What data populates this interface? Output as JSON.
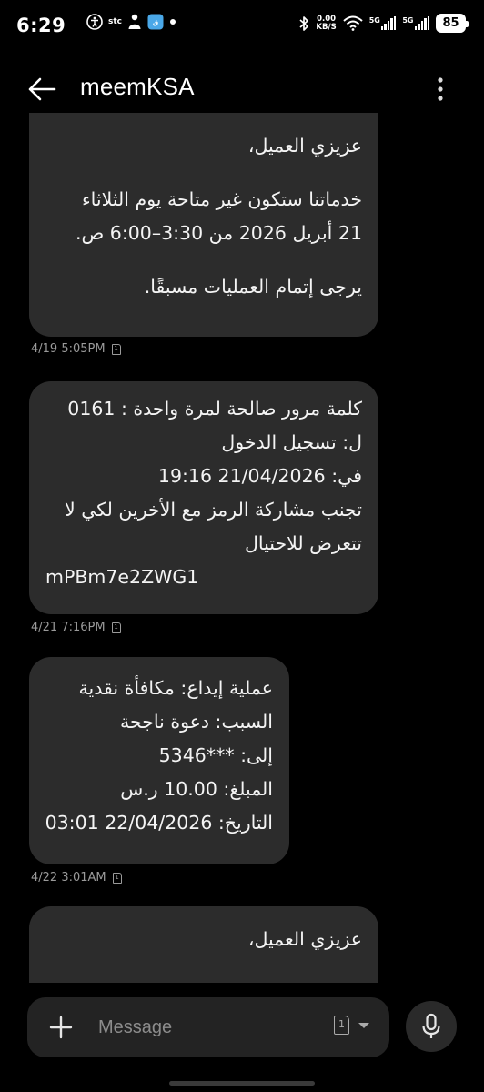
{
  "status_bar": {
    "time": "6:29",
    "carrier": "stc",
    "net_speed_value": "0.00",
    "net_speed_unit": "KB/S",
    "signal1_label": "5G",
    "signal2_label": "5G",
    "battery": "85"
  },
  "header": {
    "title": "meemKSA"
  },
  "messages": [
    {
      "lines": [
        "عزيزي العميل،",
        "",
        "خدماتنا ستكون غير متاحة يوم الثلاثاء",
        "21 أبريل 2026 من 3:30–6:00 ص.",
        "",
        "يرجى إتمام العمليات مسبقًا."
      ],
      "timestamp": "4/19 5:05PM",
      "sim": "1"
    },
    {
      "lines": [
        "كلمة مرور صالحة لمرة واحدة : 0161",
        "ل: تسجيل الدخول",
        "في: 21/04/2026 19:16",
        "تجنب مشاركة الرمز مع الأخرين لكي لا",
        "تتعرض للاحتيال",
        "mPBm7e2ZWG1"
      ],
      "timestamp": "4/21 7:16PM",
      "sim": "1"
    },
    {
      "lines": [
        "عملية إيداع: مكافأة نقدية",
        "السبب: دعوة ناجحة",
        "إلى: ***5346",
        "المبلغ: 10.00 ر.س",
        "التاريخ: 22/04/2026 03:01"
      ],
      "timestamp": "4/22 3:01AM",
      "sim": "1"
    },
    {
      "lines": [
        "عزيزي العميل،"
      ],
      "timestamp": "",
      "sim": ""
    }
  ],
  "compose": {
    "placeholder": "Message",
    "sim": "1"
  },
  "icons": {
    "back": "arrow-back-icon",
    "more": "more-vertical-icon",
    "add": "plus-icon",
    "mic": "microphone-icon",
    "sim": "sim-card-icon",
    "bluetooth": "bluetooth-icon",
    "wifi": "wifi-icon"
  }
}
